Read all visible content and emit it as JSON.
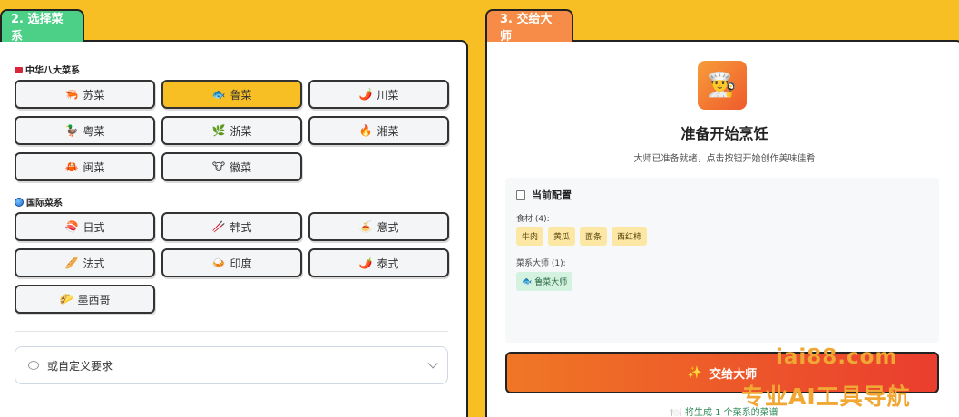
{
  "tabs": {
    "left": "2. 选择菜系",
    "right": "3. 交给大师"
  },
  "chinese": {
    "title": "中华八大菜系",
    "items": [
      {
        "icon": "🦐",
        "label": "苏菜"
      },
      {
        "icon": "🐟",
        "label": "鲁菜"
      },
      {
        "icon": "🌶️",
        "label": "川菜"
      },
      {
        "icon": "🦆",
        "label": "粤菜"
      },
      {
        "icon": "🌿",
        "label": "浙菜"
      },
      {
        "icon": "🔥",
        "label": "湘菜"
      },
      {
        "icon": "🦀",
        "label": "闽菜"
      },
      {
        "icon": "🐮",
        "label": "徽菜"
      }
    ],
    "selected": "鲁菜"
  },
  "international": {
    "title": "国际菜系",
    "items": [
      {
        "icon": "🍣",
        "label": "日式"
      },
      {
        "icon": "🥢",
        "label": "韩式"
      },
      {
        "icon": "🍝",
        "label": "意式"
      },
      {
        "icon": "🥖",
        "label": "法式"
      },
      {
        "icon": "🍛",
        "label": "印度"
      },
      {
        "icon": "🌶️",
        "label": "泰式"
      },
      {
        "icon": "🌮",
        "label": "墨西哥"
      }
    ]
  },
  "custom": {
    "label": "或自定义要求"
  },
  "right_panel": {
    "logo_icon": "👨‍🍳",
    "title": "准备开始烹饪",
    "subtitle": "大师已准备就绪，点击按钮开始创作美味佳肴",
    "config_title": "当前配置",
    "ingredients_label": "食材 (4):",
    "ingredients": [
      "牛肉",
      "黄瓜",
      "面条",
      "西红柿"
    ],
    "masters_label": "菜系大师 (1):",
    "masters": [
      {
        "icon": "🐟",
        "label": "鲁菜大师"
      }
    ],
    "button_icon": "✨",
    "button_label": "交给大师",
    "footnote": "🍽️ 将生成 1 个菜系的菜谱"
  },
  "watermark": {
    "url": "iai88.com",
    "slogan": "专业AI工具导航"
  },
  "colors": {
    "background": "#f7bf23",
    "tab_left": "#4ccf86",
    "tab_right": "#f68c47",
    "selected": "#f7bf23",
    "button_start": "#f07725",
    "button_end": "#ea3d2e"
  }
}
